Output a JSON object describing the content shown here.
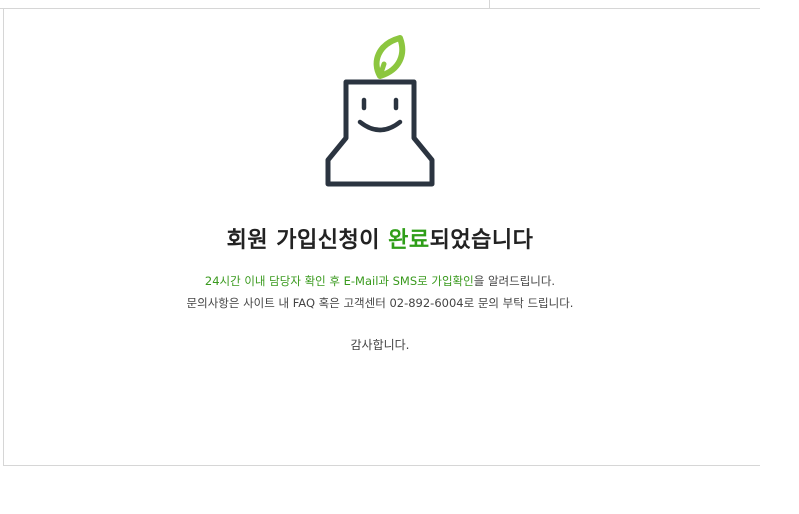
{
  "colors": {
    "accent_green": "#2f9e18",
    "leaf_green": "#8cc63f",
    "outline_dark": "#2b3440",
    "text_dark": "#222222",
    "text_body": "#444444"
  },
  "mascot": {
    "icon": "smiling-pot-with-sprout-icon"
  },
  "headline": {
    "prefix": "회원 가입신청이 ",
    "highlight": "완료",
    "suffix": "되었습니다"
  },
  "message": {
    "line1_green_prefix": "24시간 이내 담당자 확인 후 E-Mail과 SMS로 가입확인",
    "line1_suffix": "을 알려드립니다.",
    "line2": "문의사항은 사이트 내 FAQ 혹은 고객센터 02-892-6004로 문의 부탁 드립니다."
  },
  "thanks": "감사합니다."
}
